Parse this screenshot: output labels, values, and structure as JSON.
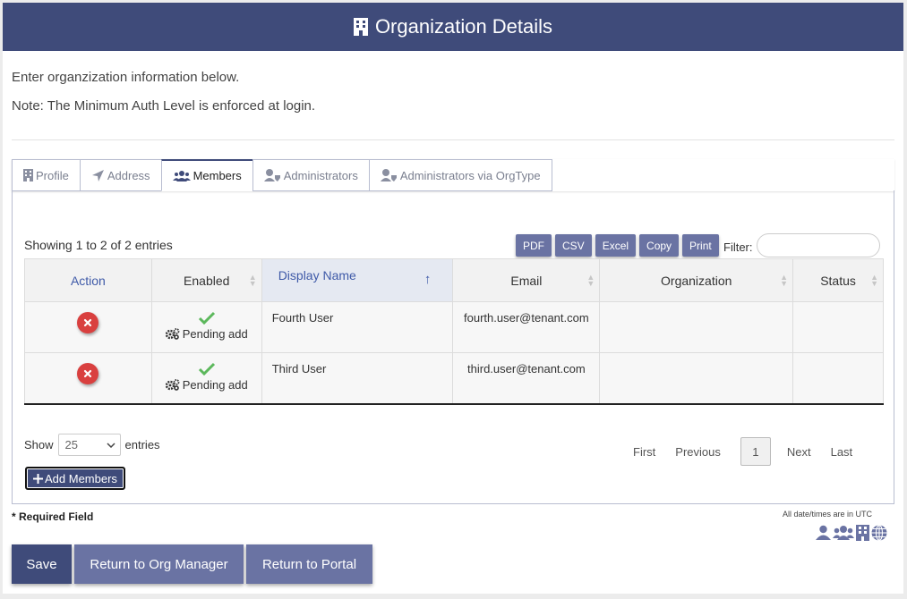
{
  "header": {
    "title": "Organization Details",
    "icon": "building-icon"
  },
  "intro": {
    "line1": "Enter organzization information below.",
    "line2": "Note: The Minimum Auth Level is enforced at login."
  },
  "tabs": [
    {
      "label": "Profile",
      "icon": "building-icon"
    },
    {
      "label": "Address",
      "icon": "location-arrow-icon"
    },
    {
      "label": "Members",
      "icon": "users-icon",
      "active": true
    },
    {
      "label": "Administrators",
      "icon": "user-shield-icon"
    },
    {
      "label": "Administrators via OrgType",
      "icon": "user-shield-icon"
    }
  ],
  "table": {
    "info": "Showing 1 to 2 of 2 entries",
    "export_buttons": [
      "PDF",
      "CSV",
      "Excel",
      "Copy",
      "Print"
    ],
    "filter_label": "Filter:",
    "filter_value": "",
    "columns": [
      "Action",
      "Enabled",
      "Display Name",
      "Email",
      "Organization",
      "Status"
    ],
    "sorted_column": "Display Name",
    "rows": [
      {
        "status_text": "Pending add",
        "display_name": "Fourth User",
        "email": "fourth.user@tenant.com",
        "organization": "",
        "status": ""
      },
      {
        "status_text": "Pending add",
        "display_name": "Third User",
        "email": "third.user@tenant.com",
        "organization": "",
        "status": ""
      }
    ],
    "show_label": "Show",
    "page_size": "25",
    "entries_label": "entries",
    "pager": {
      "first": "First",
      "previous": "Previous",
      "current": "1",
      "next": "Next",
      "last": "Last"
    },
    "add_button": "Add Members"
  },
  "footer": {
    "required": "* Required Field",
    "utc_note": "All date/times are in UTC",
    "buttons": {
      "save": "Save",
      "return_org": "Return to Org Manager",
      "return_portal": "Return to Portal"
    }
  },
  "colors": {
    "header_bg": "#3f4b7a",
    "button_bg": "#6a73a3",
    "delete": "#d9403f",
    "check": "#5cb85c"
  }
}
